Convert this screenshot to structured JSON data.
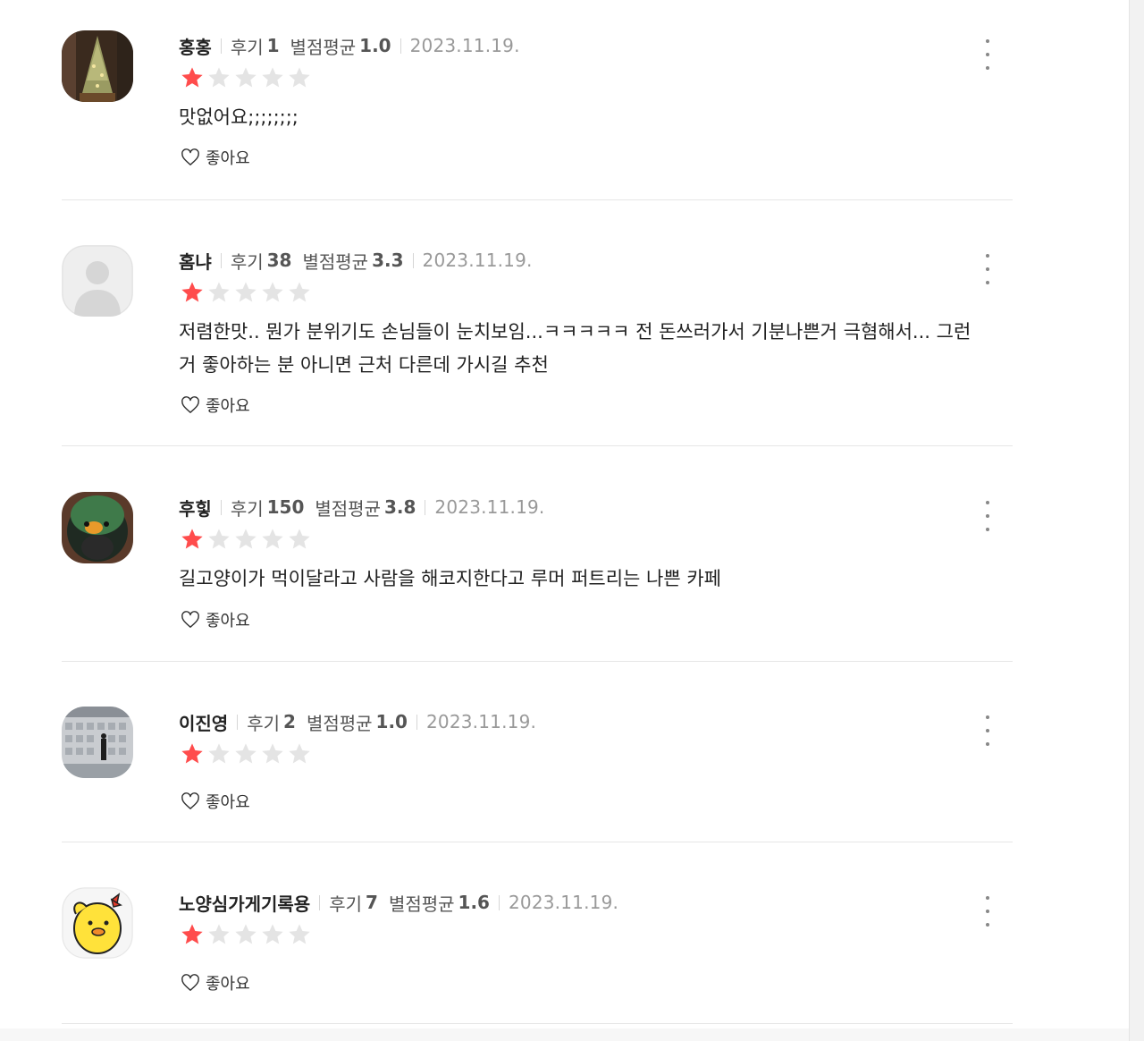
{
  "labels": {
    "review_count": "후기",
    "rating_avg": "별점평균",
    "like": "좋아요"
  },
  "colors": {
    "star_filled": "#ff4c4c",
    "star_empty": "#e4e4e4",
    "divider": "#e6e6e6"
  },
  "reviews": [
    {
      "nickname": "홍홍",
      "review_count": "1",
      "rating_avg": "1.0",
      "date": "2023.11.19.",
      "rating": 1,
      "text": "맛없어요;;;;;;;;",
      "avatar": "christmas-tree-photo"
    },
    {
      "nickname": "홈냐",
      "review_count": "38",
      "rating_avg": "3.3",
      "date": "2023.11.19.",
      "rating": 1,
      "text": "저렴한맛.. 뭔가 분위기도 손님들이 눈치보임...ㅋㅋㅋㅋㅋ 전 돈쓰러가서 기분나쁜거 극혐해서... 그런거 좋아하는 분 아니면 근처 다른데 가시길 추천",
      "avatar": "default-profile"
    },
    {
      "nickname": "후힣",
      "review_count": "150",
      "rating_avg": "3.8",
      "date": "2023.11.19.",
      "rating": 1,
      "text": "길고양이가 먹이달라고 사람을 해코지한다고 루머 퍼트리는 나쁜 카페",
      "avatar": "green-bird-photo"
    },
    {
      "nickname": "이진영",
      "review_count": "2",
      "rating_avg": "1.0",
      "date": "2023.11.19.",
      "rating": 1,
      "text": "",
      "avatar": "gallery-wall-photo"
    },
    {
      "nickname": "노양심가게기록용",
      "review_count": "7",
      "rating_avg": "1.6",
      "date": "2023.11.19.",
      "rating": 1,
      "text": "",
      "avatar": "yellow-chick-character"
    }
  ]
}
